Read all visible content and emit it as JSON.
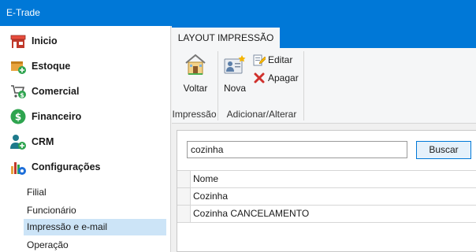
{
  "app": {
    "title": "E-Trade"
  },
  "sidebar": {
    "items": [
      {
        "label": "Inicio",
        "icon": "store-icon"
      },
      {
        "label": "Estoque",
        "icon": "box-add-icon"
      },
      {
        "label": "Comercial",
        "icon": "cart-money-icon"
      },
      {
        "label": "Financeiro",
        "icon": "dollar-icon"
      },
      {
        "label": "CRM",
        "icon": "person-add-icon"
      },
      {
        "label": "Configurações",
        "icon": "chart-gear-icon"
      }
    ],
    "subitems": [
      "Filial",
      "Funcionário",
      "Impressão e e-mail",
      "Operação"
    ],
    "active_subitem": "Impressão e e-mail"
  },
  "ribbon": {
    "tab": "LAYOUT IMPRESSÃO",
    "groups": [
      {
        "label": "Impressão",
        "buttons": [
          "Voltar"
        ]
      },
      {
        "label": "Adicionar/Alterar",
        "buttons": [
          "Nova",
          "Editar",
          "Apagar"
        ]
      }
    ]
  },
  "search": {
    "value": "cozinha",
    "button": "Buscar"
  },
  "table": {
    "header": "Nome",
    "rows": [
      "Cozinha",
      "Cozinha CANCELAMENTO"
    ]
  }
}
